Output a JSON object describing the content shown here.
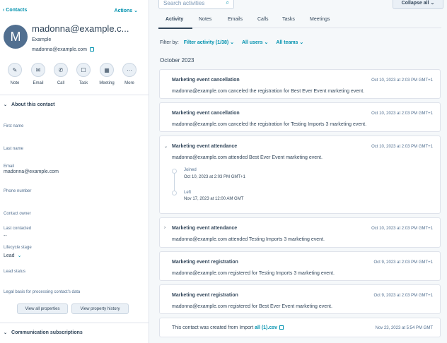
{
  "left": {
    "back_label": "‹ Contacts",
    "actions_label": "Actions ⌄",
    "avatar_letter": "M",
    "contact_name": "madonna@example.c...",
    "company": "Example",
    "email": "madonna@example.com",
    "action_buttons": [
      {
        "label": "Note",
        "icon": "note-icon",
        "glyph": "✎"
      },
      {
        "label": "Email",
        "icon": "email-icon",
        "glyph": "✉"
      },
      {
        "label": "Call",
        "icon": "call-icon",
        "glyph": "✆"
      },
      {
        "label": "Task",
        "icon": "task-icon",
        "glyph": "☐"
      },
      {
        "label": "Meeting",
        "icon": "meeting-icon",
        "glyph": "▦"
      },
      {
        "label": "More",
        "icon": "more-icon",
        "glyph": "···"
      }
    ],
    "about_heading": "About this contact",
    "fields": {
      "first_name": {
        "label": "First name",
        "value": ""
      },
      "last_name": {
        "label": "Last name",
        "value": ""
      },
      "email": {
        "label": "Email",
        "value": "madonna@example.com"
      },
      "phone": {
        "label": "Phone number",
        "value": ""
      },
      "owner": {
        "label": "Contact owner",
        "value": ""
      },
      "last_contacted": {
        "label": "Last contacted",
        "value": "--"
      },
      "lifecycle": {
        "label": "Lifecycle stage",
        "value": "Lead"
      },
      "lead_status": {
        "label": "Lead status",
        "value": ""
      },
      "legal_basis": {
        "label": "Legal basis for processing contact's data",
        "value": ""
      }
    },
    "view_all_label": "View all properties",
    "view_history_label": "View property history",
    "comm_heading": "Communication subscriptions"
  },
  "right": {
    "search_placeholder": "Search activities",
    "collapse_label": "Collapse all ⌄",
    "tabs": [
      "Activity",
      "Notes",
      "Emails",
      "Calls",
      "Tasks",
      "Meetings"
    ],
    "filter_by": "Filter by:",
    "filter_activity": "Filter activity (1/38) ⌄",
    "all_users": "All users ⌄",
    "all_teams": "All teams ⌄",
    "month": "October 2023",
    "cards": [
      {
        "title": "Marketing event cancellation",
        "time": "Oct 10, 2023 at 2:03 PM GMT+1",
        "desc": "madonna@example.com canceled the registration for Best Ever Event marketing event."
      },
      {
        "title": "Marketing event cancellation",
        "time": "Oct 10, 2023 at 2:03 PM GMT+1",
        "desc": "madonna@example.com canceled the registration for Testing Imports 3 marketing event."
      },
      {
        "title": "Marketing event attendance",
        "time": "Oct 10, 2023 at 2:03 PM GMT+1",
        "desc": "madonna@example.com attended Best Ever Event marketing event.",
        "joined_label": "Joined",
        "joined_time": "Oct 10, 2023 at 2:03 PM GMT+1",
        "left_label": "Left",
        "left_time": "Nov 17, 2023 at 12:00 AM GMT"
      },
      {
        "title": "Marketing event attendance",
        "time": "Oct 10, 2023 at 2:03 PM GMT+1",
        "desc": "madonna@example.com attended Testing Imports 3 marketing event."
      },
      {
        "title": "Marketing event registration",
        "time": "Oct 9, 2023 at 2:03 PM GMT+1",
        "desc": "madonna@example.com registered for Testing Imports 3 marketing event."
      },
      {
        "title": "Marketing event registration",
        "time": "Oct 9, 2023 at 2:03 PM GMT+1",
        "desc": "madonna@example.com registered for Best Ever Event marketing event."
      },
      {
        "desc_prefix": "This contact was created from Import ",
        "link": "all (1).csv",
        "time": "Nov 23, 2023 at 5:54 PM GMT"
      }
    ]
  }
}
